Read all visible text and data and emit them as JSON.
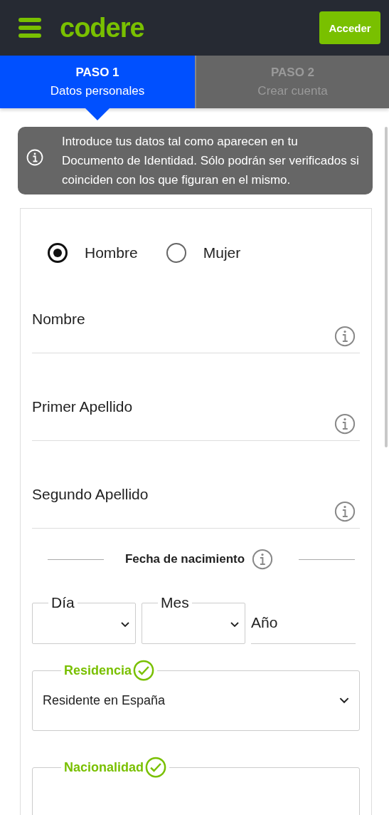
{
  "header": {
    "brand": "codere",
    "login_button": "Acceder"
  },
  "steps": [
    {
      "number": "PASO 1",
      "label": "Datos personales",
      "selected": true
    },
    {
      "number": "PASO 2",
      "label": "Crear cuenta",
      "selected": false
    }
  ],
  "notice": "Introduce tus datos tal como aparecen en tu Documento de Identidad. Sólo podrán ser verificados si coinciden con los que figuran en el mismo.",
  "gender_options": [
    {
      "label": "Hombre",
      "selected": true
    },
    {
      "label": "Mujer",
      "selected": false
    }
  ],
  "text_fields": [
    {
      "label": "Nombre"
    },
    {
      "label": "Primer Apellido"
    },
    {
      "label": "Segundo Apellido"
    }
  ],
  "birth_date": {
    "label": "Fecha de nacimiento",
    "day_label": "Día",
    "month_label": "Mes",
    "year_label": "Año"
  },
  "residence": {
    "label": "Residencia",
    "valid": true,
    "value": "Residente en España"
  },
  "nationality": {
    "label": "Nacionalidad",
    "valid": true
  }
}
